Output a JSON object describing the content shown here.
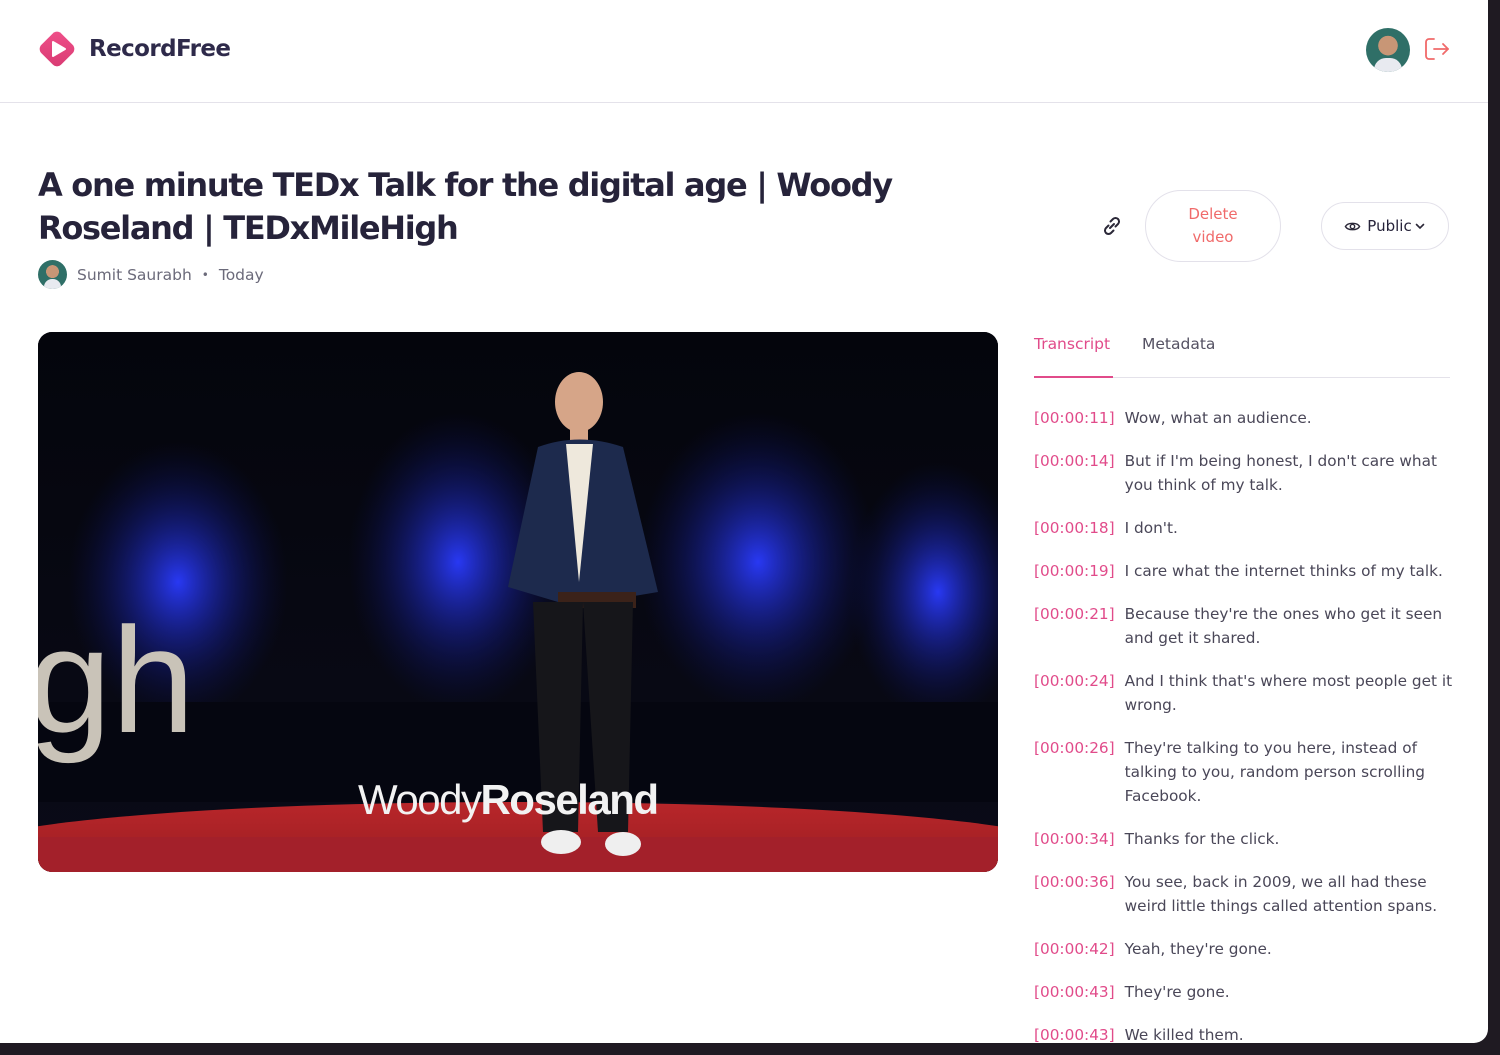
{
  "app": {
    "brand": "RecordFree",
    "accent": "#e14b8a",
    "danger": "#f06a6a"
  },
  "header": {
    "avatar_icon": "user-avatar",
    "logout_icon": "logout-icon"
  },
  "video": {
    "title": "A one minute TEDx Talk for the digital age | Woody Roseland | TEDxMileHigh",
    "author": "Sumit Saurabh",
    "separator": "•",
    "date": "Today",
    "overlay_text_light": "Woody",
    "overlay_text_bold": "Roseland",
    "stage_text": "gh"
  },
  "actions": {
    "copy_link_icon": "link-icon",
    "delete_label": "Delete video",
    "visibility_label": "Public"
  },
  "tabs": [
    {
      "label": "Transcript",
      "active": true
    },
    {
      "label": "Metadata",
      "active": false
    }
  ],
  "transcript": [
    {
      "time": "[00:00:11]",
      "text": "Wow, what an audience."
    },
    {
      "time": "[00:00:14]",
      "text": "But if I'm being honest, I don't care what you think of my talk."
    },
    {
      "time": "[00:00:18]",
      "text": "I don't."
    },
    {
      "time": "[00:00:19]",
      "text": "I care what the internet thinks of my talk."
    },
    {
      "time": "[00:00:21]",
      "text": "Because they're the ones who get it seen and get it shared."
    },
    {
      "time": "[00:00:24]",
      "text": "And I think that's where most people get it wrong."
    },
    {
      "time": "[00:00:26]",
      "text": "They're talking to you here, instead of talking to you, random person scrolling Facebook."
    },
    {
      "time": "[00:00:34]",
      "text": "Thanks for the click."
    },
    {
      "time": "[00:00:36]",
      "text": "You see, back in 2009, we all had these weird little things called attention spans."
    },
    {
      "time": "[00:00:42]",
      "text": "Yeah, they're gone."
    },
    {
      "time": "[00:00:43]",
      "text": "They're gone."
    },
    {
      "time": "[00:00:43]",
      "text": "We killed them."
    }
  ]
}
